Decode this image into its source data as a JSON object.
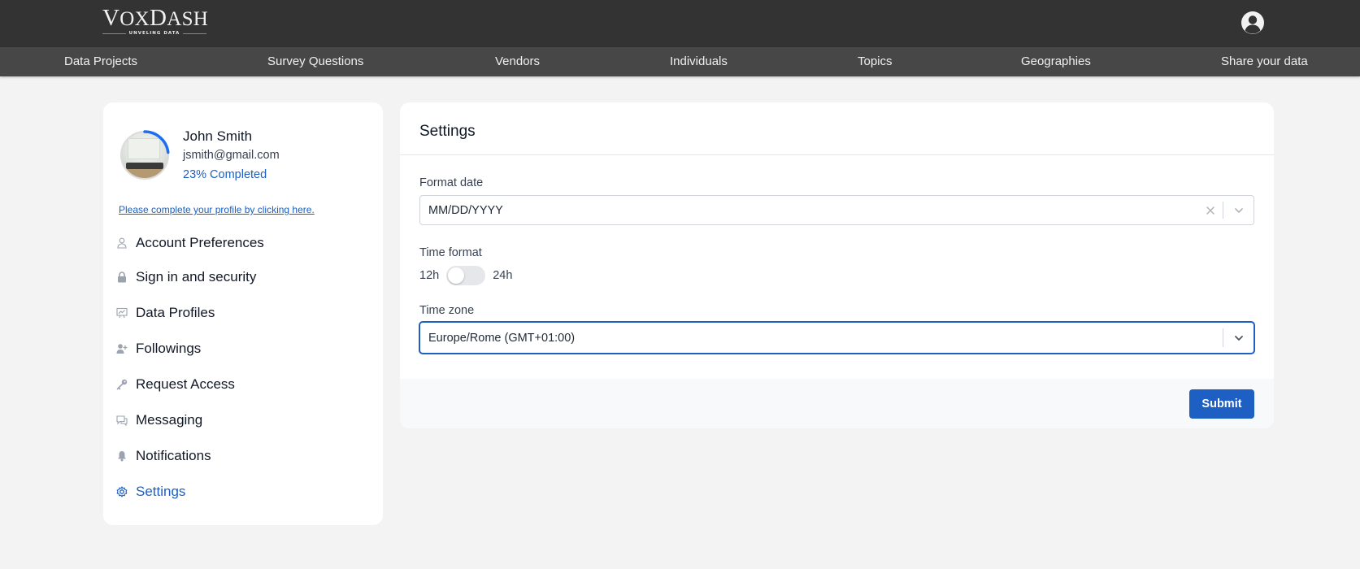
{
  "brand": {
    "logo_first": "V",
    "logo_middle": "OX",
    "logo_second": "D",
    "logo_end": "ASH",
    "tagline": "UNVELING DATA"
  },
  "nav": {
    "items": [
      {
        "label": "Data Projects"
      },
      {
        "label": "Survey Questions"
      },
      {
        "label": "Vendors"
      },
      {
        "label": "Individuals"
      },
      {
        "label": "Topics"
      },
      {
        "label": "Geographies"
      },
      {
        "label": "Share your data"
      }
    ]
  },
  "profile": {
    "name": "John Smith",
    "email": "jsmith@gmail.com",
    "progress_label": "23% Completed",
    "progress_fraction": 0.23,
    "complete_link": "Please complete your profile by clicking here."
  },
  "sidebar": {
    "items": [
      {
        "label": "Account Preferences",
        "icon": "user-icon"
      },
      {
        "label": "Sign in and security",
        "icon": "lock-icon"
      },
      {
        "label": "Data Profiles",
        "icon": "chart-board-icon"
      },
      {
        "label": "Followings",
        "icon": "user-plus-icon"
      },
      {
        "label": "Request Access",
        "icon": "key-icon"
      },
      {
        "label": "Messaging",
        "icon": "chat-icon"
      },
      {
        "label": "Notifications",
        "icon": "bell-icon"
      },
      {
        "label": "Settings",
        "icon": "gear-icon",
        "active": true
      }
    ]
  },
  "settings": {
    "title": "Settings",
    "format_date": {
      "label": "Format date",
      "value": "MM/DD/YYYY"
    },
    "time_format": {
      "label": "Time format",
      "left_option": "12h",
      "right_option": "24h",
      "is_24h": false
    },
    "time_zone": {
      "label": "Time zone",
      "value": "Europe/Rome (GMT+01:00)"
    },
    "submit_label": "Submit"
  },
  "colors": {
    "topbar": "#333333",
    "navbar": "#474747",
    "accent": "#1d5fc2",
    "background": "#f3f3f3"
  }
}
